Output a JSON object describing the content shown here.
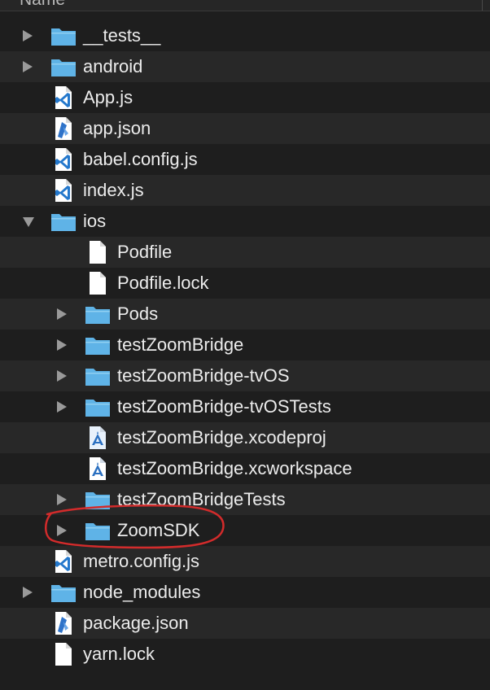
{
  "header": {
    "column_label": "Name"
  },
  "colors": {
    "folder": "#5fb3e6",
    "annotation": "#d32b2b",
    "row_alt": "#282828"
  },
  "items": [
    {
      "label": "__tests__",
      "depth": 0,
      "kind": "folder",
      "disclosure": "closed",
      "icon": "folder-icon"
    },
    {
      "label": "android",
      "depth": 0,
      "kind": "folder",
      "disclosure": "closed",
      "icon": "folder-icon"
    },
    {
      "label": "App.js",
      "depth": 0,
      "kind": "vscode-file",
      "disclosure": "none",
      "icon": "vscode-file-icon"
    },
    {
      "label": "app.json",
      "depth": 0,
      "kind": "json-file",
      "disclosure": "none",
      "icon": "json-file-icon"
    },
    {
      "label": "babel.config.js",
      "depth": 0,
      "kind": "vscode-file",
      "disclosure": "none",
      "icon": "vscode-file-icon"
    },
    {
      "label": "index.js",
      "depth": 0,
      "kind": "vscode-file",
      "disclosure": "none",
      "icon": "vscode-file-icon"
    },
    {
      "label": "ios",
      "depth": 0,
      "kind": "folder",
      "disclosure": "open",
      "icon": "folder-icon"
    },
    {
      "label": "Podfile",
      "depth": 1,
      "kind": "plain-file",
      "disclosure": "none",
      "icon": "document-icon"
    },
    {
      "label": "Podfile.lock",
      "depth": 1,
      "kind": "plain-file",
      "disclosure": "none",
      "icon": "document-icon"
    },
    {
      "label": "Pods",
      "depth": 1,
      "kind": "folder",
      "disclosure": "closed",
      "icon": "folder-icon"
    },
    {
      "label": "testZoomBridge",
      "depth": 1,
      "kind": "folder",
      "disclosure": "closed",
      "icon": "folder-icon"
    },
    {
      "label": "testZoomBridge-tvOS",
      "depth": 1,
      "kind": "folder",
      "disclosure": "closed",
      "icon": "folder-icon"
    },
    {
      "label": "testZoomBridge-tvOSTests",
      "depth": 1,
      "kind": "folder",
      "disclosure": "closed",
      "icon": "folder-icon"
    },
    {
      "label": "testZoomBridge.xcodeproj",
      "depth": 1,
      "kind": "xcode-file",
      "disclosure": "none",
      "icon": "xcodeproj-icon"
    },
    {
      "label": "testZoomBridge.xcworkspace",
      "depth": 1,
      "kind": "xcworkspace-file",
      "disclosure": "none",
      "icon": "xcworkspace-icon"
    },
    {
      "label": "testZoomBridgeTests",
      "depth": 1,
      "kind": "folder",
      "disclosure": "closed",
      "icon": "folder-icon"
    },
    {
      "label": "ZoomSDK",
      "depth": 1,
      "kind": "folder",
      "disclosure": "closed",
      "icon": "folder-icon"
    },
    {
      "label": "metro.config.js",
      "depth": 0,
      "kind": "vscode-file",
      "disclosure": "none",
      "icon": "vscode-file-icon"
    },
    {
      "label": "node_modules",
      "depth": 0,
      "kind": "folder",
      "disclosure": "closed",
      "icon": "folder-icon"
    },
    {
      "label": "package.json",
      "depth": 0,
      "kind": "json-file",
      "disclosure": "none",
      "icon": "json-file-icon"
    },
    {
      "label": "yarn.lock",
      "depth": 0,
      "kind": "plain-file",
      "disclosure": "none",
      "icon": "document-icon"
    }
  ]
}
